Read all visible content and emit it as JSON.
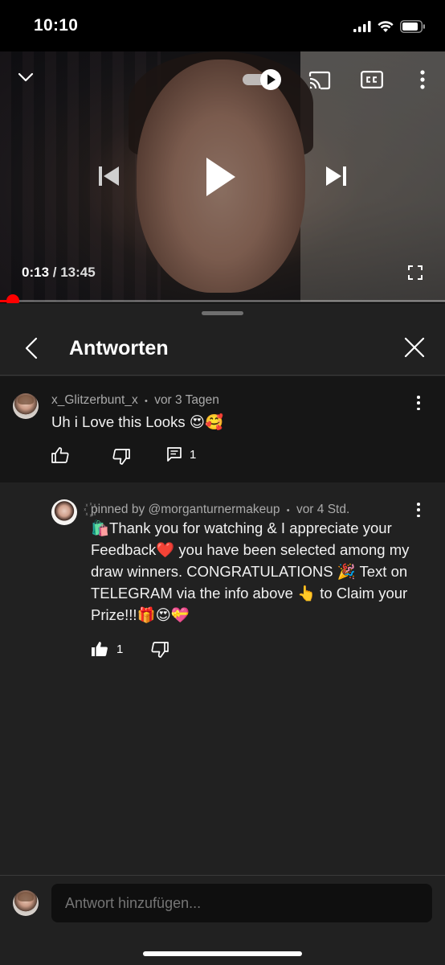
{
  "status_bar": {
    "time": "10:10"
  },
  "player": {
    "current_time": "0:13",
    "separator": " / ",
    "duration": "13:45",
    "progress_fraction": 0.016,
    "autoplay_on": true,
    "icons": {
      "minimize": "chevron-down-icon",
      "autoplay": "autoplay-toggle",
      "cast": "cast-icon",
      "captions": "cc-icon",
      "more": "more-vert-icon",
      "previous": "skip-previous-icon",
      "play": "play-icon",
      "next": "skip-next-icon",
      "fullscreen": "fullscreen-icon"
    },
    "accent_color": "#ff0000"
  },
  "panel": {
    "title": "Antworten",
    "parent_comment": {
      "author": "x_Glitzerbunt_x",
      "dot": "•",
      "time": "vor 3 Tagen",
      "text": "Uh i Love this Looks 😍🥰",
      "replies_count": "1"
    },
    "reply": {
      "pin_prefix": "꙰",
      "pinned_by": "pinned by @morganturnermakeup",
      "dot": "•",
      "time": "vor 4 Std.",
      "text": "🛍️Thank you for watching & I appreciate your Feedback❤️  you have been selected among my draw winners. CONGRATULATIONS 🎉 Text on TELEGRAM via the info above 👆 to Claim your Prize!!!🎁😍💝",
      "likes_count": "1"
    },
    "input": {
      "placeholder": "Antwort hinzufügen..."
    }
  }
}
